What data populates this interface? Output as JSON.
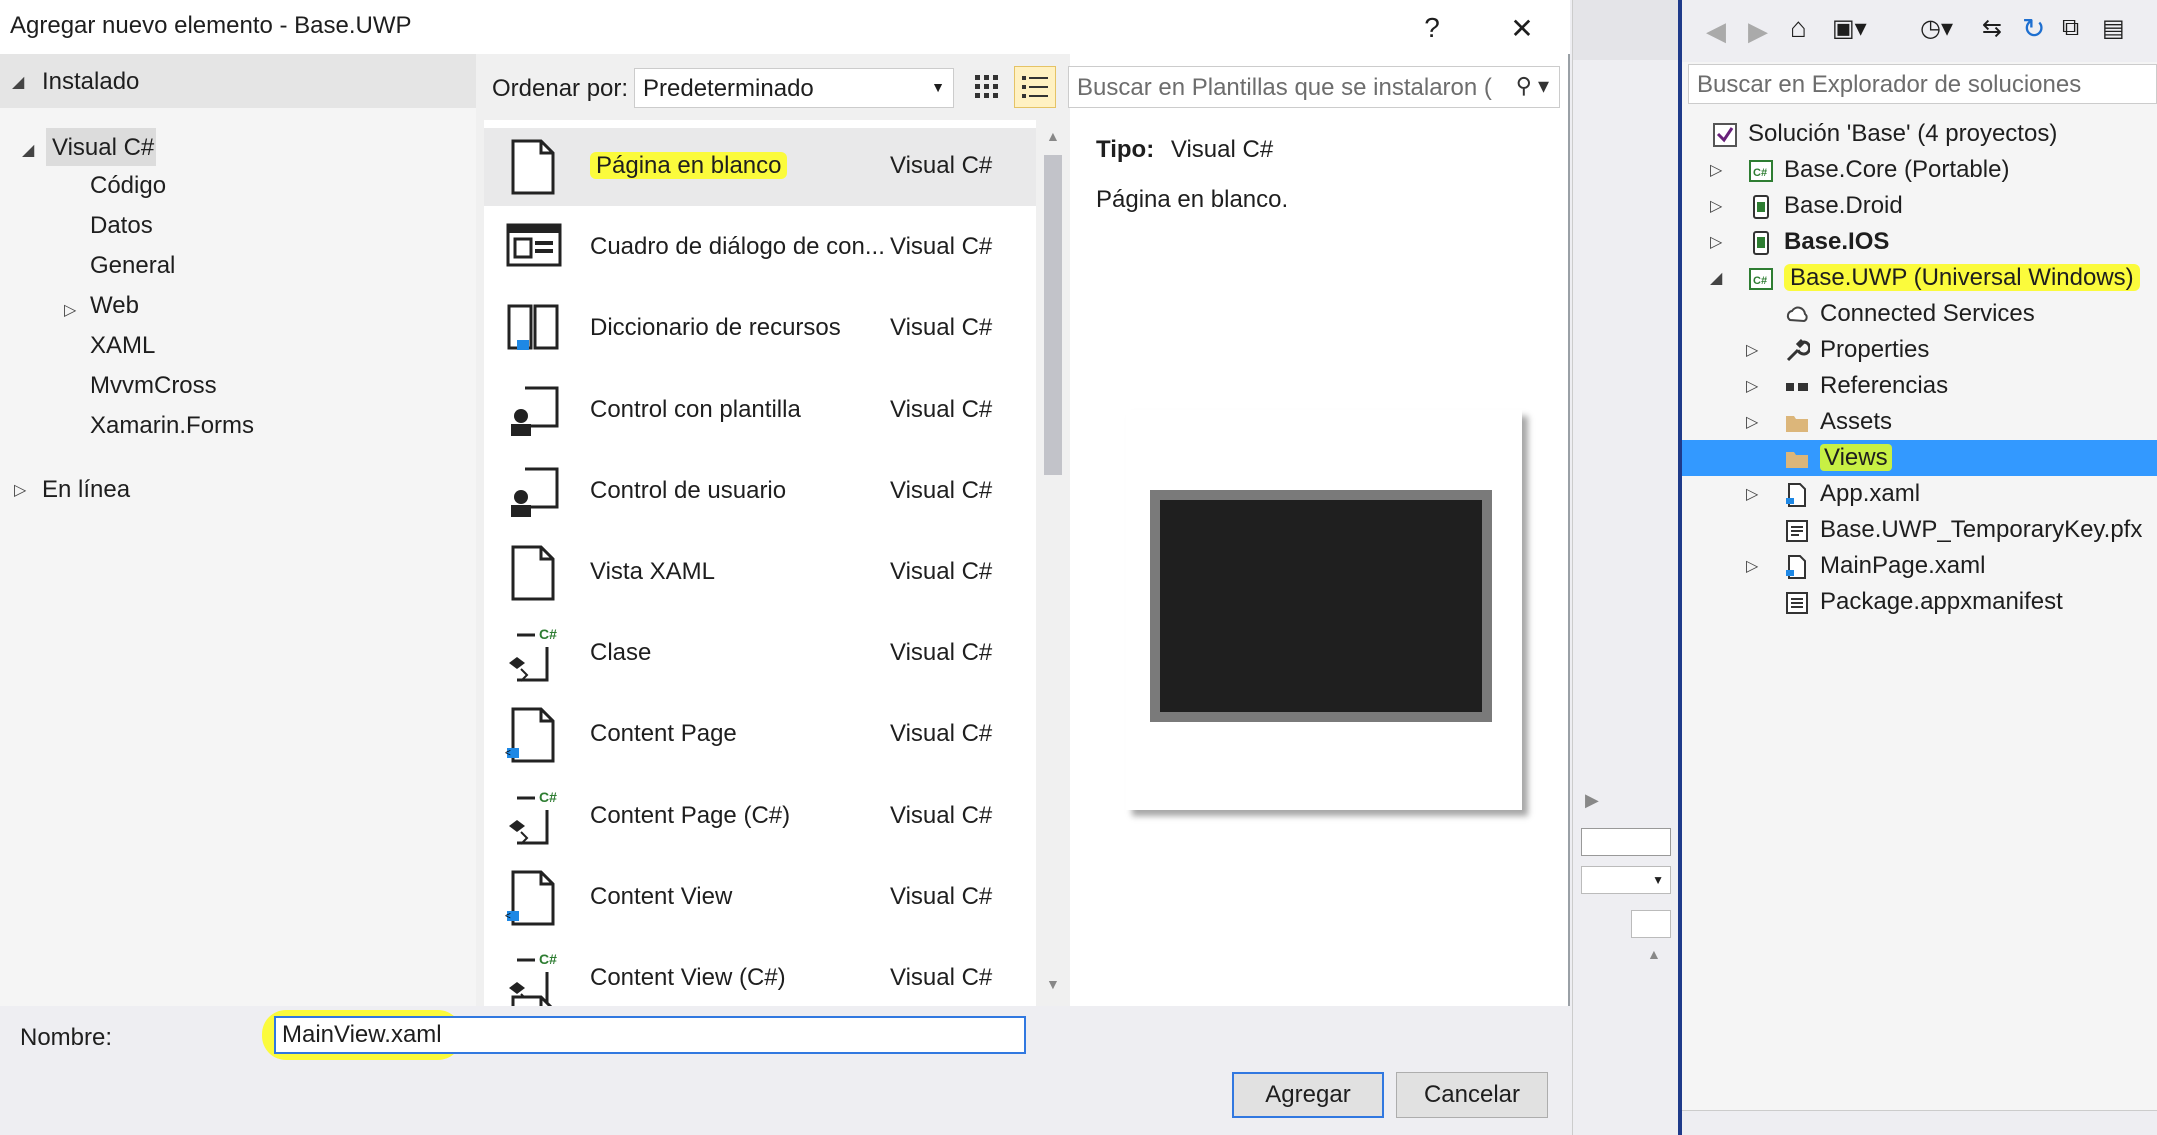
{
  "dialog": {
    "title": "Agregar nuevo elemento - Base.UWP",
    "help_label": "?",
    "close_label": "✕"
  },
  "left_tree": {
    "installed": "Instalado",
    "root": "Visual C#",
    "children": [
      "Código",
      "Datos",
      "General",
      "Web",
      "XAML",
      "MvvmCross",
      "Xamarin.Forms"
    ],
    "online": "En línea"
  },
  "toolbar": {
    "sort_label": "Ordenar por:",
    "sort_value": "Predeterminado",
    "search_placeholder": "Buscar en Plantillas que se instalaron ("
  },
  "templates": [
    {
      "name": "Página en blanco",
      "lang": "Visual C#"
    },
    {
      "name": "Cuadro de diálogo de con...",
      "lang": "Visual C#"
    },
    {
      "name": "Diccionario de recursos",
      "lang": "Visual C#"
    },
    {
      "name": "Control con plantilla",
      "lang": "Visual C#"
    },
    {
      "name": "Control de usuario",
      "lang": "Visual C#"
    },
    {
      "name": "Vista XAML",
      "lang": "Visual C#"
    },
    {
      "name": "Clase",
      "lang": "Visual C#"
    },
    {
      "name": "Content Page",
      "lang": "Visual C#"
    },
    {
      "name": "Content Page (C#)",
      "lang": "Visual C#"
    },
    {
      "name": "Content View",
      "lang": "Visual C#"
    },
    {
      "name": "Content View (C#)",
      "lang": "Visual C#"
    }
  ],
  "info": {
    "type_label": "Tipo:",
    "type_value": "Visual C#",
    "description": "Página en blanco."
  },
  "footer": {
    "name_label": "Nombre:",
    "name_value": "MainView.xaml",
    "add_button": "Agregar",
    "cancel_button": "Cancelar"
  },
  "solution_explorer": {
    "search_placeholder": "Buscar en Explorador de soluciones",
    "solution": "Solución 'Base'  (4 proyectos)",
    "items": [
      {
        "label": "Base.Core (Portable)"
      },
      {
        "label": "Base.Droid"
      },
      {
        "label": "Base.IOS"
      },
      {
        "label": "Base.UWP (Universal Windows)"
      },
      {
        "label": "Connected Services"
      },
      {
        "label": "Properties"
      },
      {
        "label": "Referencias"
      },
      {
        "label": "Assets"
      },
      {
        "label": "Views"
      },
      {
        "label": "App.xaml"
      },
      {
        "label": "Base.UWP_TemporaryKey.pfx"
      },
      {
        "label": "MainPage.xaml"
      },
      {
        "label": "Package.appxmanifest"
      }
    ]
  },
  "colors": {
    "highlight_yellow": "#fbfb3c",
    "selection_blue": "#3399ff",
    "accent_blue": "#3178e0"
  }
}
